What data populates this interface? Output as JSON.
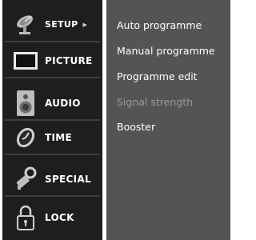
{
  "sidebar": {
    "items": [
      {
        "label": "SETUP",
        "icon": "satellite-dish-icon",
        "active": true
      },
      {
        "label": "PICTURE",
        "icon": "screen-icon"
      },
      {
        "label": "AUDIO",
        "icon": "speaker-icon"
      },
      {
        "label": "TIME",
        "icon": "clock-icon"
      },
      {
        "label": "SPECIAL",
        "icon": "key-icon"
      },
      {
        "label": "LOCK",
        "icon": "padlock-icon"
      }
    ],
    "active_arrow": "▶"
  },
  "submenu": {
    "items": [
      {
        "label": "Auto programme",
        "enabled": true
      },
      {
        "label": "Manual programme",
        "enabled": true
      },
      {
        "label": "Programme edit",
        "enabled": true
      },
      {
        "label": "Signal strength",
        "enabled": false
      },
      {
        "label": "Booster",
        "enabled": true
      }
    ]
  },
  "colors": {
    "sidebar_bg": "#1e1e1e",
    "panel_bg": "#545454",
    "text": "#ffffff",
    "disabled_text": "#9a9a9a"
  }
}
